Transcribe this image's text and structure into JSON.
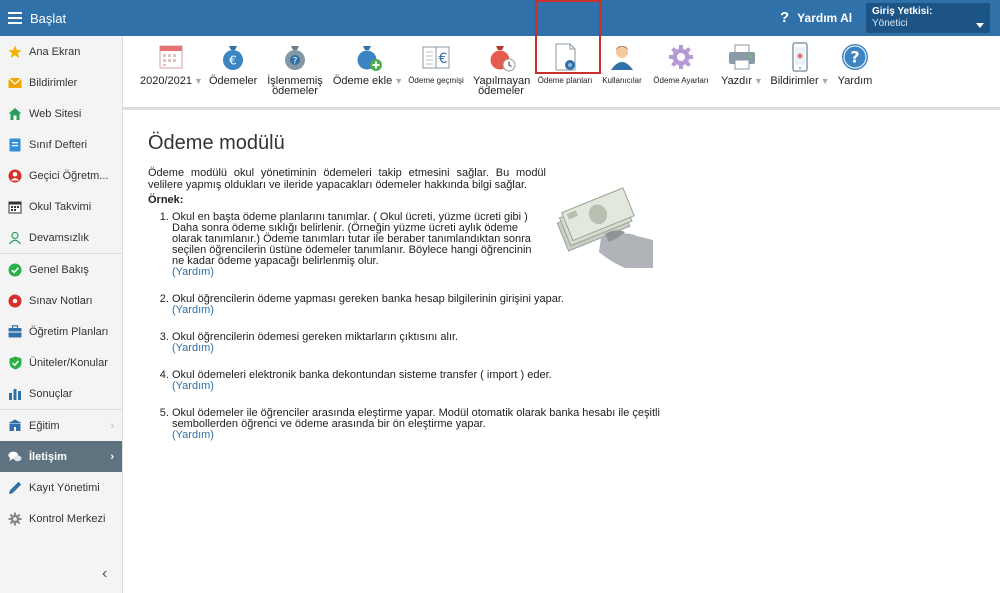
{
  "topbar": {
    "menu_label": "Başlat",
    "help_label": "Yardım Al",
    "help_mark": "?",
    "auth_title": "Giriş Yetkisi:",
    "auth_value": "Yönetici"
  },
  "sidebar": {
    "items": [
      {
        "label": "Ana Ekran",
        "icon": "star-icon",
        "color": "#f0b400"
      },
      {
        "label": "Bildirimler",
        "icon": "envelope-icon",
        "color": "#f0a500"
      },
      {
        "label": "Web Sitesi",
        "icon": "home-icon",
        "color": "#2a9d5c"
      },
      {
        "label": "Sınıf Defteri",
        "icon": "notebook-icon",
        "color": "#2f8fd8"
      },
      {
        "label": "Geçici Öğretm...",
        "icon": "person-icon",
        "color": "#d9302c"
      },
      {
        "label": "Okul Takvimi",
        "icon": "calendar-icon",
        "color": "#333333"
      },
      {
        "label": "Devamsızlık",
        "icon": "user-outline-icon",
        "color": "#2a9d5c"
      },
      {
        "label": "Genel Bakış",
        "icon": "check-circle-icon",
        "color": "#2ab04a"
      },
      {
        "label": "Sınav Notları",
        "icon": "grade-icon",
        "color": "#d9302c"
      },
      {
        "label": "Öğretim Planları",
        "icon": "briefcase-icon",
        "color": "#2f71a8"
      },
      {
        "label": "Üniteler/Konular",
        "icon": "shield-check-icon",
        "color": "#2ab04a"
      },
      {
        "label": "Sonuçlar",
        "icon": "bar-chart-icon",
        "color": "#2f71a8"
      },
      {
        "label": "Eğitim",
        "icon": "school-icon",
        "color": "#2f71a8"
      },
      {
        "label": "İletişim",
        "icon": "chat-icon",
        "color": "#ffffff"
      },
      {
        "label": "Kayıt Yönetimi",
        "icon": "pen-icon",
        "color": "#2f71a8"
      },
      {
        "label": "Kontrol Merkezi",
        "icon": "gear-icon",
        "color": "#888888"
      }
    ],
    "collapse_glyph": "‹"
  },
  "toolbar": {
    "year": "2020/2021",
    "payments": "Ödemeler",
    "unprocessed_1": "İşlenmemiş",
    "unprocessed_2": "ödemeler",
    "add_payment": "Ödeme ekle",
    "history": "Ödeme geçmişi",
    "unpaid_1": "Yapılmayan",
    "unpaid_2": "ödemeler",
    "plans": "Ödeme planları",
    "users": "Kullanıcılar",
    "settings": "Ödeme Ayarları",
    "print": "Yazdır",
    "notifications": "Bildirimler",
    "help": "Yardım",
    "euro": "€",
    "question": "?"
  },
  "content": {
    "title": "Ödeme modülü",
    "intro": "Ödeme modülü okul yönetiminin ödemeleri takip etmesini sağlar. Bu modül velilere yapmış oldukları ve ileride yapacakları ödemeler hakkında bilgi sağlar.",
    "example_label": "Örnek:",
    "help_link": "(Yardım)",
    "steps": [
      "Okul en başta ödeme planlarını tanımlar. ( Okul ücreti, yüzme ücreti gibi ) Daha sonra ödeme sıklığı belirlenir. (Örneğin yüzme ücreti aylık ödeme olarak tanımlanır.) Ödeme tanımları tutar ile beraber tanımlandıktan sonra seçilen öğrencilerin üstüne ödemeler tanımlanır. Böylece hangi öğrencinin ne kadar ödeme yapacağı belirlenmiş olur.",
      "Okul öğrencilerin ödeme yapması gereken banka hesap bilgilerinin girişini yapar.",
      "Okul öğrencilerin ödemesi gereken miktarların çıktısını alır.",
      "Okul ödemeleri elektronik banka dekontundan sisteme transfer ( import ) eder.",
      "Okul ödemeler ile öğrenciler arasında eleştirme yapar. Modül otomatik olarak banka hesabı ile çeşitli sembollerden öğrenci ve ödeme arasında bir ön eleştirme yapar."
    ]
  },
  "colors": {
    "topbar": "#2f71a8",
    "active_sidebar": "#5f7280",
    "selection_frame": "#c9302c",
    "link": "#2f71a8"
  }
}
